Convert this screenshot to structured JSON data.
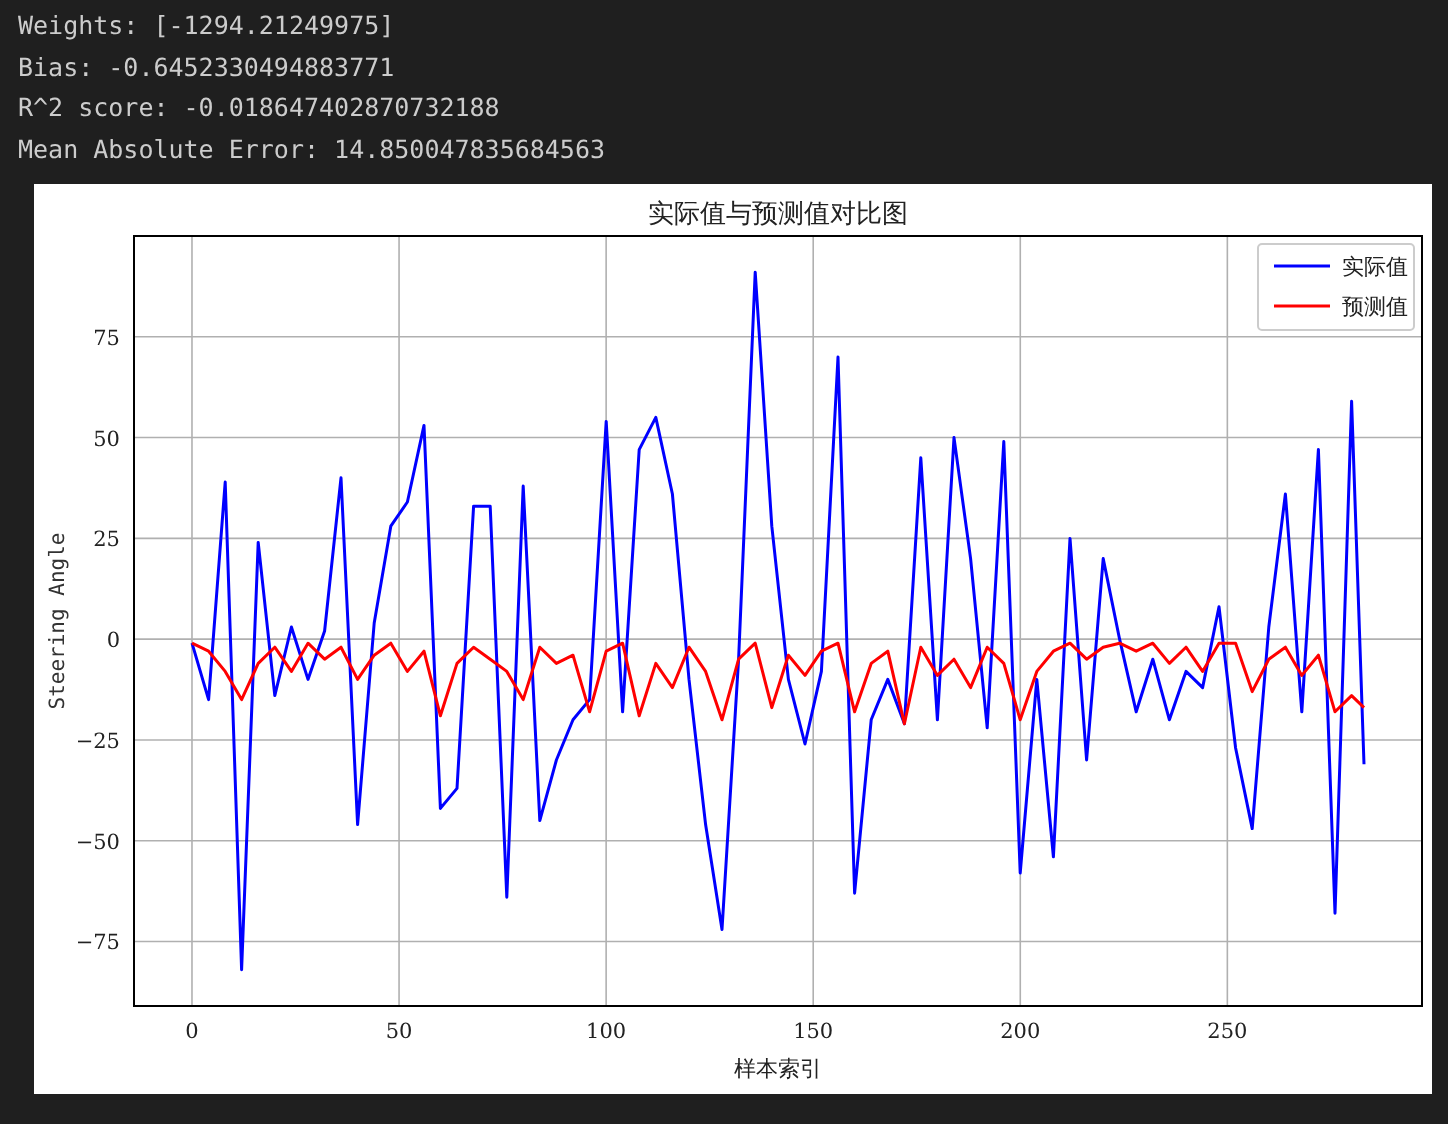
{
  "output_lines": [
    "Weights: [-1294.21249975]",
    "Bias: -0.6452330494883771",
    "R^2 score: -0.018647402870732188",
    "Mean Absolute Error: 14.850047835684563"
  ],
  "figure": {
    "chart_data": {
      "type": "line",
      "title": "实际值与预测值对比图",
      "xlabel": "样本索引",
      "ylabel": "Steering Angle",
      "x": [
        0,
        4,
        8,
        12,
        16,
        20,
        24,
        28,
        32,
        36,
        40,
        44,
        48,
        52,
        56,
        60,
        64,
        68,
        72,
        76,
        80,
        84,
        88,
        92,
        96,
        100,
        104,
        108,
        112,
        116,
        120,
        124,
        128,
        132,
        136,
        140,
        144,
        148,
        152,
        156,
        160,
        164,
        168,
        172,
        176,
        180,
        184,
        188,
        192,
        196,
        200,
        204,
        208,
        212,
        216,
        220,
        224,
        228,
        232,
        236,
        240,
        244,
        248,
        252,
        256,
        260,
        264,
        268,
        272,
        276,
        280,
        283
      ],
      "series": [
        {
          "name": "实际值",
          "color": "#0000ff",
          "values": [
            -1,
            -15,
            39,
            -82,
            24,
            -14,
            3,
            -10,
            2,
            40,
            -46,
            4,
            28,
            34,
            53,
            -42,
            -37,
            33,
            33,
            -64,
            38,
            -45,
            -30,
            -20,
            -15,
            54,
            -18,
            47,
            55,
            36,
            -10,
            -46,
            -72,
            -5,
            91,
            28,
            -10,
            -26,
            -8,
            70,
            -63,
            -20,
            -10,
            -21,
            45,
            -20,
            50,
            20,
            -22,
            49,
            -58,
            -10,
            -54,
            25,
            -30,
            20,
            0,
            -18,
            -5,
            -20,
            -8,
            -12,
            8,
            -27,
            -47,
            3,
            36,
            -18,
            47,
            -68,
            59,
            -31
          ]
        },
        {
          "name": "预测值",
          "color": "#ff0000",
          "values": [
            -1,
            -3,
            -8,
            -15,
            -6,
            -2,
            -8,
            -1,
            -5,
            -2,
            -10,
            -4,
            -1,
            -8,
            -3,
            -19,
            -6,
            -2,
            -5,
            -8,
            -15,
            -2,
            -6,
            -4,
            -18,
            -3,
            -1,
            -19,
            -6,
            -12,
            -2,
            -8,
            -20,
            -5,
            -1,
            -17,
            -4,
            -9,
            -3,
            -1,
            -18,
            -6,
            -3,
            -21,
            -2,
            -9,
            -5,
            -12,
            -2,
            -6,
            -20,
            -8,
            -3,
            -1,
            -5,
            -2,
            -1,
            -3,
            -1,
            -6,
            -2,
            -8,
            -1,
            -1,
            -13,
            -5,
            -2,
            -9,
            -4,
            -18,
            -14,
            -17
          ]
        }
      ],
      "grid": true,
      "legend": true,
      "xlim": [
        -14,
        297
      ],
      "ylim": [
        -91,
        100
      ],
      "xticks": [
        0,
        50,
        100,
        150,
        200,
        250
      ],
      "yticks": [
        -75,
        -50,
        -25,
        0,
        25,
        50,
        75
      ]
    }
  }
}
